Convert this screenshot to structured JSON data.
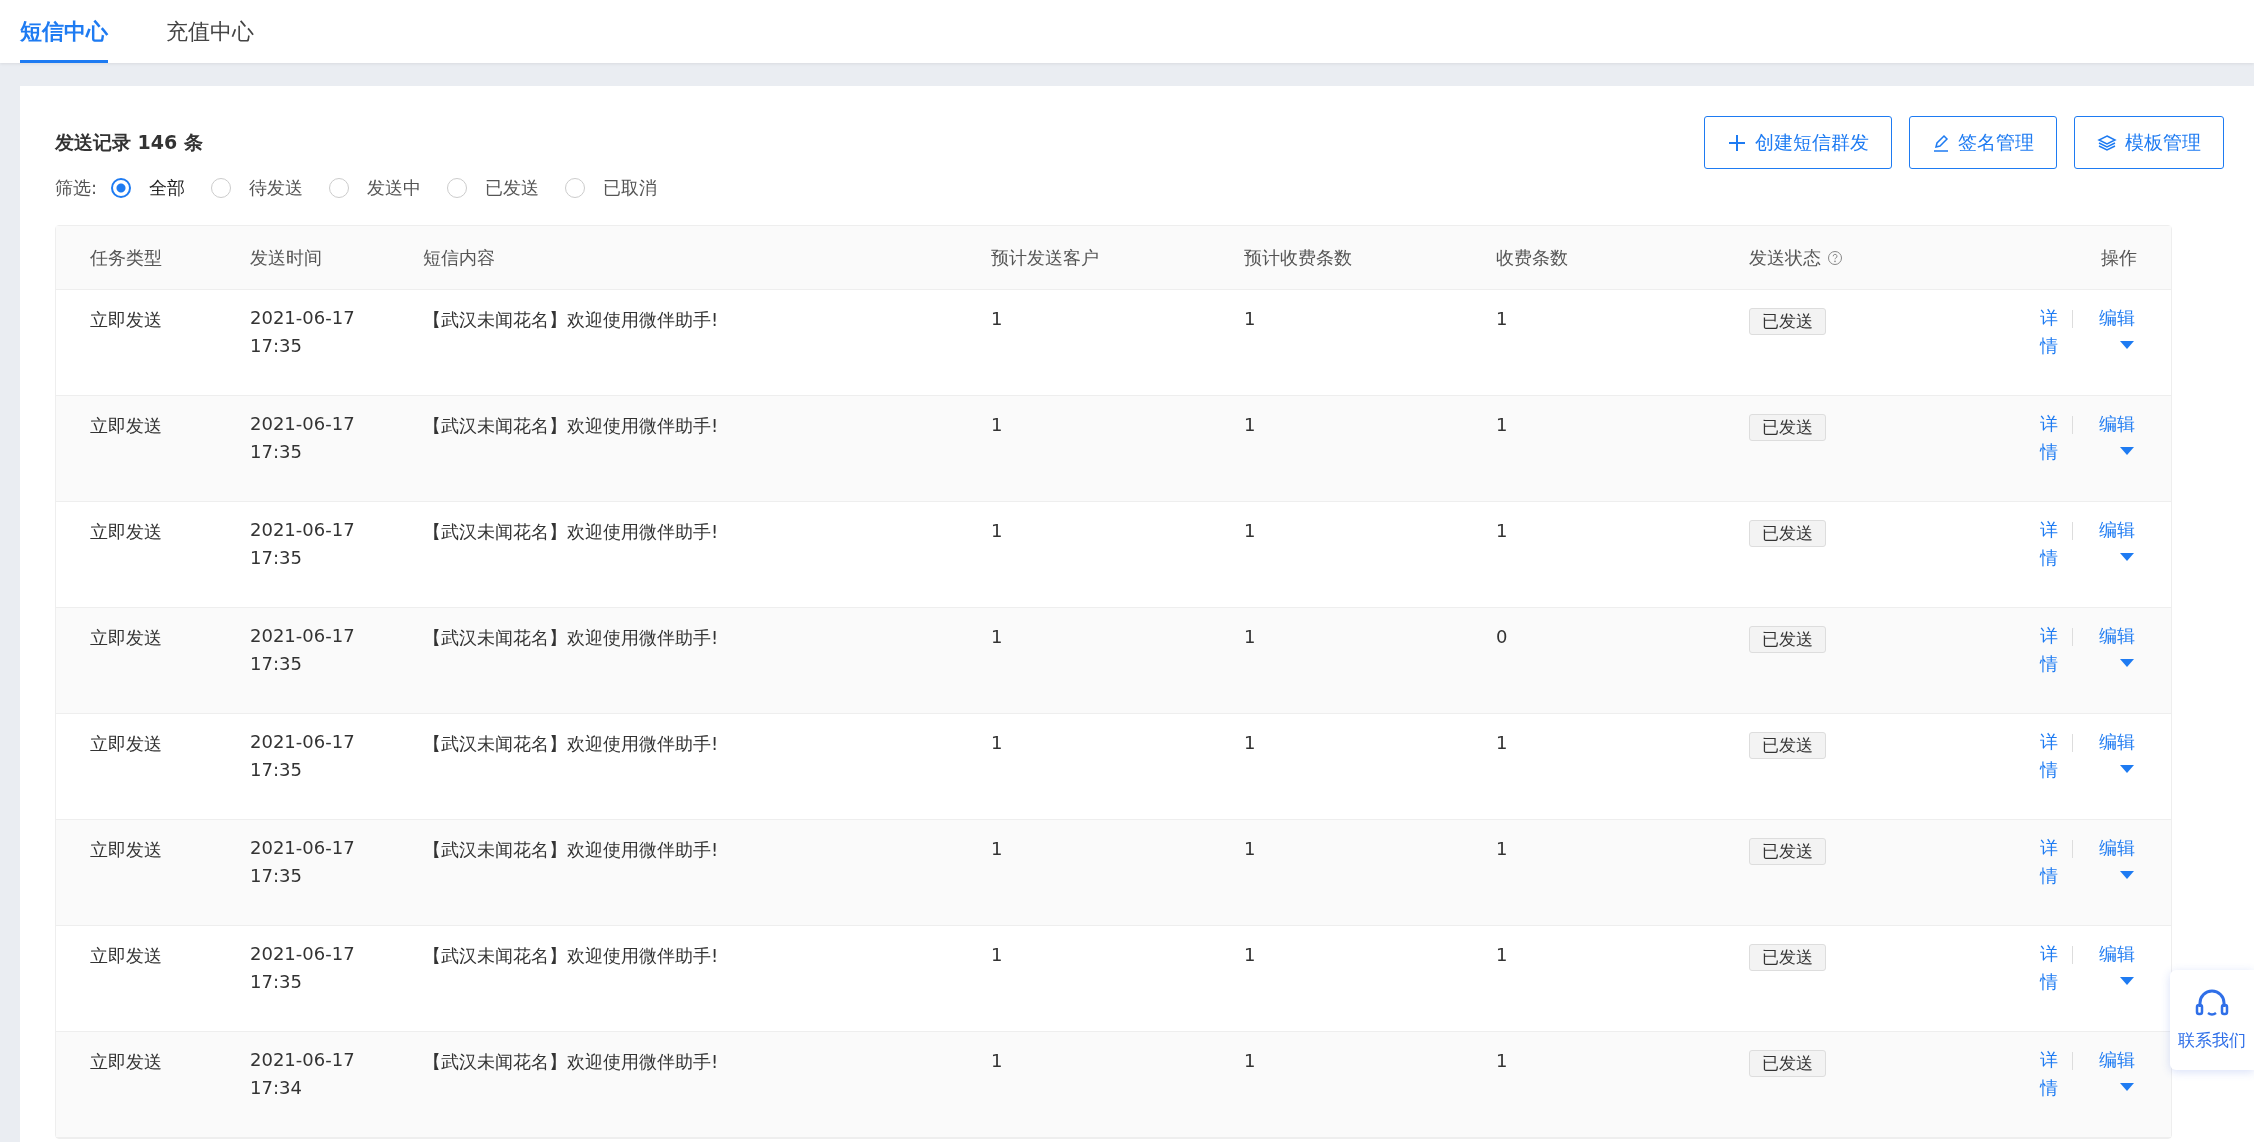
{
  "tabs": [
    {
      "label": "短信中心",
      "selected": true
    },
    {
      "label": "充值中心",
      "selected": false
    }
  ],
  "record_title": "发送记录 146 条",
  "filter": {
    "label": "筛选:",
    "options": [
      {
        "label": "全部",
        "selected": true
      },
      {
        "label": "待发送",
        "selected": false
      },
      {
        "label": "发送中",
        "selected": false
      },
      {
        "label": "已发送",
        "selected": false
      },
      {
        "label": "已取消",
        "selected": false
      }
    ]
  },
  "buttons": [
    {
      "kind": "plus",
      "label": "创建短信群发"
    },
    {
      "kind": "pencil",
      "label": "签名管理"
    },
    {
      "kind": "layers",
      "label": "模板管理"
    }
  ],
  "table": {
    "columns": [
      {
        "kind": "plain",
        "label": "任务类型"
      },
      {
        "kind": "plain",
        "label": "发送时间"
      },
      {
        "kind": "plain",
        "label": "短信内容"
      },
      {
        "kind": "plain",
        "label": "预计发送客户"
      },
      {
        "kind": "plain",
        "label": "预计收费条数"
      },
      {
        "kind": "plain",
        "label": "收费条数"
      },
      {
        "kind": "help",
        "label": "发送状态"
      },
      {
        "kind": "plain",
        "label": "操作"
      }
    ],
    "rows": [
      {
        "task_type": "立即发送",
        "send_date": "2021-06-17",
        "send_time": "17:35",
        "content": "【武汉未闻花名】欢迎使用微伴助手!",
        "est_customers": "1",
        "est_charges": "1",
        "charges": "1",
        "status": "已发送",
        "detail": "详情",
        "edit": "编辑"
      },
      {
        "task_type": "立即发送",
        "send_date": "2021-06-17",
        "send_time": "17:35",
        "content": "【武汉未闻花名】欢迎使用微伴助手!",
        "est_customers": "1",
        "est_charges": "1",
        "charges": "1",
        "status": "已发送",
        "detail": "详情",
        "edit": "编辑"
      },
      {
        "task_type": "立即发送",
        "send_date": "2021-06-17",
        "send_time": "17:35",
        "content": "【武汉未闻花名】欢迎使用微伴助手!",
        "est_customers": "1",
        "est_charges": "1",
        "charges": "1",
        "status": "已发送",
        "detail": "详情",
        "edit": "编辑"
      },
      {
        "task_type": "立即发送",
        "send_date": "2021-06-17",
        "send_time": "17:35",
        "content": "【武汉未闻花名】欢迎使用微伴助手!",
        "est_customers": "1",
        "est_charges": "1",
        "charges": "0",
        "status": "已发送",
        "detail": "详情",
        "edit": "编辑"
      },
      {
        "task_type": "立即发送",
        "send_date": "2021-06-17",
        "send_time": "17:35",
        "content": "【武汉未闻花名】欢迎使用微伴助手!",
        "est_customers": "1",
        "est_charges": "1",
        "charges": "1",
        "status": "已发送",
        "detail": "详情",
        "edit": "编辑"
      },
      {
        "task_type": "立即发送",
        "send_date": "2021-06-17",
        "send_time": "17:35",
        "content": "【武汉未闻花名】欢迎使用微伴助手!",
        "est_customers": "1",
        "est_charges": "1",
        "charges": "1",
        "status": "已发送",
        "detail": "详情",
        "edit": "编辑"
      },
      {
        "task_type": "立即发送",
        "send_date": "2021-06-17",
        "send_time": "17:35",
        "content": "【武汉未闻花名】欢迎使用微伴助手!",
        "est_customers": "1",
        "est_charges": "1",
        "charges": "1",
        "status": "已发送",
        "detail": "详情",
        "edit": "编辑"
      },
      {
        "task_type": "立即发送",
        "send_date": "2021-06-17",
        "send_time": "17:34",
        "content": "【武汉未闻花名】欢迎使用微伴助手!",
        "est_customers": "1",
        "est_charges": "1",
        "charges": "1",
        "status": "已发送",
        "detail": "详情",
        "edit": "编辑"
      }
    ]
  },
  "contact": {
    "label": "联系我们"
  }
}
